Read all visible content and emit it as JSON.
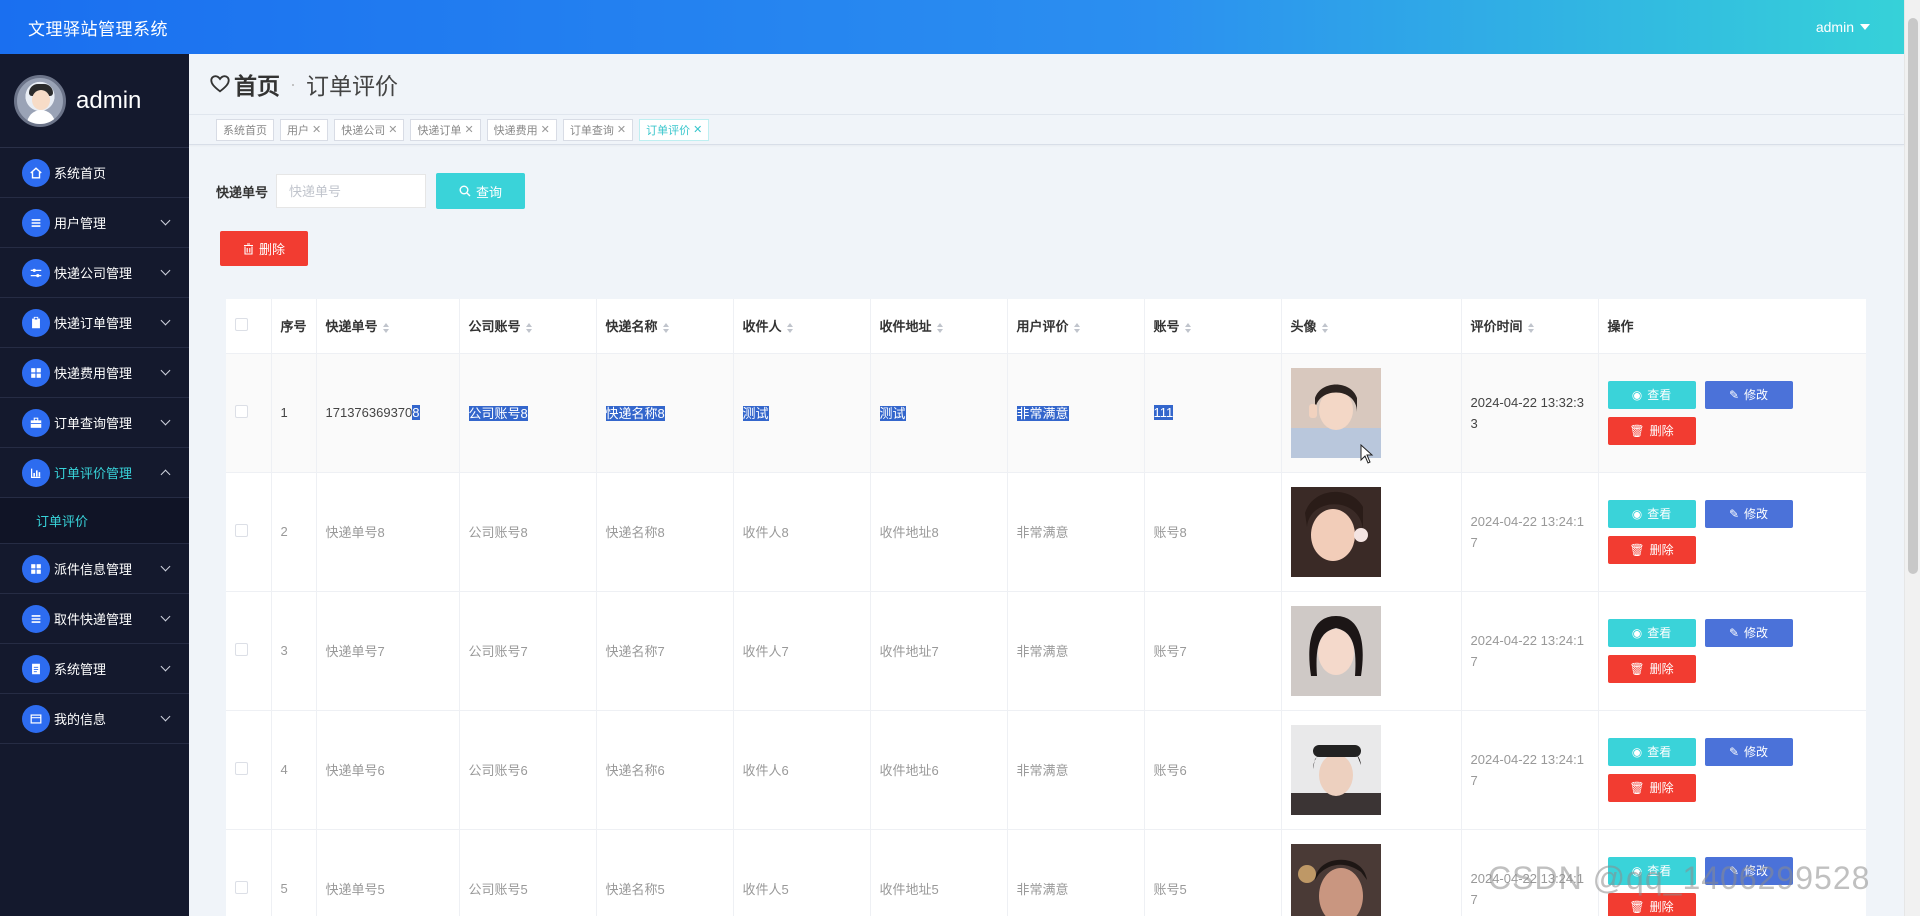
{
  "app": {
    "title": "文理驿站管理系统",
    "user": "admin"
  },
  "profile": {
    "name": "admin"
  },
  "sidebar": {
    "items": [
      {
        "label": "系统首页",
        "icon": "home-icon"
      },
      {
        "label": "用户管理",
        "icon": "list-icon"
      },
      {
        "label": "快递公司管理",
        "icon": "sliders-icon"
      },
      {
        "label": "快递订单管理",
        "icon": "clipboard-icon"
      },
      {
        "label": "快递费用管理",
        "icon": "grid-icon"
      },
      {
        "label": "订单查询管理",
        "icon": "briefcase-icon"
      },
      {
        "label": "订单评价管理",
        "icon": "chart-icon"
      },
      {
        "label": "派件信息管理",
        "icon": "grid-icon"
      },
      {
        "label": "取件快递管理",
        "icon": "list-icon"
      },
      {
        "label": "系统管理",
        "icon": "doc-icon"
      },
      {
        "label": "我的信息",
        "icon": "wallet-icon"
      }
    ],
    "sub_active": "订单评价"
  },
  "breadcrumb": {
    "home": "首页",
    "current": "订单评价"
  },
  "tags": [
    {
      "label": "系统首页",
      "closable": false
    },
    {
      "label": "用户",
      "closable": true
    },
    {
      "label": "快递公司",
      "closable": true
    },
    {
      "label": "快递订单",
      "closable": true
    },
    {
      "label": "快递费用",
      "closable": true
    },
    {
      "label": "订单查询",
      "closable": true
    },
    {
      "label": "订单评价",
      "closable": true
    }
  ],
  "search": {
    "label": "快递单号",
    "placeholder": "快递单号",
    "value": "",
    "button": "查询"
  },
  "toolbar": {
    "delete": "删除"
  },
  "table": {
    "columns": [
      "序号",
      "快递单号",
      "公司账号",
      "快递名称",
      "收件人",
      "收件地址",
      "用户评价",
      "账号",
      "头像",
      "评价时间",
      "操作"
    ],
    "rows": [
      {
        "idx": "1",
        "no_a": "171376369370",
        "no_b": "8",
        "company": "公司账号8",
        "name": "快递名称8",
        "receiver": "测试",
        "address": "测试",
        "review": "非常满意",
        "account": "111",
        "time_a": "2024-04-22 13:32:3",
        "time_b": "3"
      },
      {
        "idx": "2",
        "no_a": "快递单号8",
        "no_b": "",
        "company": "公司账号8",
        "name": "快递名称8",
        "receiver": "收件人8",
        "address": "收件地址8",
        "review": "非常满意",
        "account": "账号8",
        "time_a": "2024-04-22 13:24:1",
        "time_b": "7"
      },
      {
        "idx": "3",
        "no_a": "快递单号7",
        "no_b": "",
        "company": "公司账号7",
        "name": "快递名称7",
        "receiver": "收件人7",
        "address": "收件地址7",
        "review": "非常满意",
        "account": "账号7",
        "time_a": "2024-04-22 13:24:1",
        "time_b": "7"
      },
      {
        "idx": "4",
        "no_a": "快递单号6",
        "no_b": "",
        "company": "公司账号6",
        "name": "快递名称6",
        "receiver": "收件人6",
        "address": "收件地址6",
        "review": "非常满意",
        "account": "账号6",
        "time_a": "2024-04-22 13:24:1",
        "time_b": "7"
      },
      {
        "idx": "5",
        "no_a": "快递单号5",
        "no_b": "",
        "company": "公司账号5",
        "name": "快递名称5",
        "receiver": "收件人5",
        "address": "收件地址5",
        "review": "非常满意",
        "account": "账号5",
        "time_a": "2024-04-22 13:24:1",
        "time_b": "7"
      }
    ],
    "actions": {
      "view": "查看",
      "edit": "修改",
      "delete": "删除"
    }
  },
  "watermark": "CSDN @qq_1406299528",
  "colors": {
    "accent": "#3ad3d9",
    "primary": "#2d6cf0",
    "danger": "#f23c31",
    "edit": "#4b72d9",
    "sidebar": "#14192d"
  }
}
